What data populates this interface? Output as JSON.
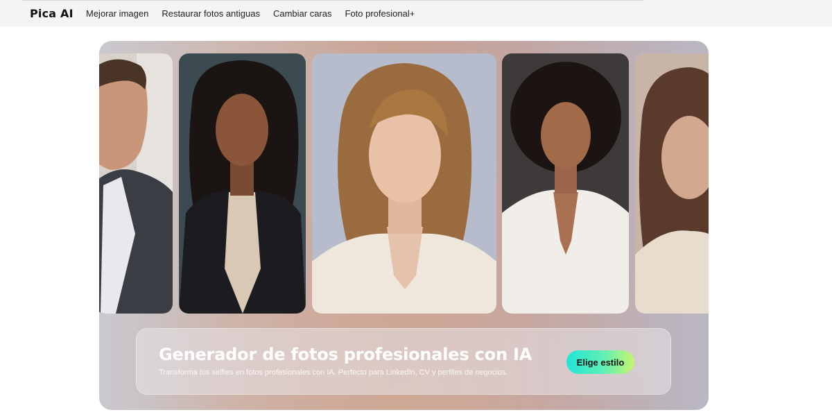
{
  "header": {
    "logo": "Pica AI",
    "nav": [
      "Mejorar imagen",
      "Restaurar fotos antiguas",
      "Cambiar caras",
      "Foto profesional+"
    ]
  },
  "hero": {
    "title": "Generador de fotos profesionales con IA",
    "subtitle": "Transforma tus selfies en fotos profesionales con IA. Perfecto para LinkedIn, CV y perfiles de negocios.",
    "cta": "Elige estilo"
  },
  "colors": {
    "cta_gradient": [
      "#22e4d8",
      "#5ff0b4",
      "#c9f56e"
    ],
    "topbar": "#f3f4f6"
  }
}
